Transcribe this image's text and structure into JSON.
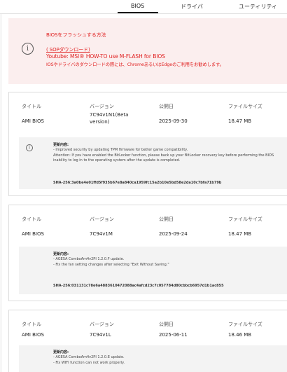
{
  "tabs": [
    {
      "label": "BIOS",
      "active": true
    },
    {
      "label": "ドライバ",
      "active": false
    },
    {
      "label": "ユーティリティ",
      "active": false
    }
  ],
  "notice": {
    "icon": "info-icon",
    "title": "BIOSをフラッシュする方法",
    "sop_link": "( SOPダウンロード)",
    "video_link": "Youtube: MSI® HOW-TO use M-FLASH for BIOS",
    "message": "IOSやドライバのダウンロードの際には、ChromeあるいはEdgeのご利用をお勧めします。",
    "color": "#e02020"
  },
  "columns": {
    "title": "タイトル",
    "version": "バージョン",
    "date": "公開日",
    "size": "ファイルサイズ"
  },
  "entries": [
    {
      "title": "AMI BIOS",
      "version_line1": "7C94v1N1(Beta",
      "version_line2": "version)",
      "date": "2025-09-30",
      "size": "18.47 MB",
      "details_title": "更新内容:",
      "details": [
        "- Improved security by updating TPM firmware for better game compatibility.",
        "Attention: If you have enabled the BitLocker function, please back up your BitLocker recovery key before performing the BIOS inability to log in to the operating system after the update is completed."
      ],
      "sha": "SHA-256:3a0be4e01ffd5f935b67e8a840ca1959fc15a2b10e5bd58e2da10c7bfa71b79b"
    },
    {
      "title": "AMI BIOS",
      "version_line1": "7C94v1M",
      "version_line2": "",
      "date": "2025-09-24",
      "size": "18.47 MB",
      "details_title": "更新内容:",
      "details": [
        "- AGESA ComboAm4v2PI 1.2.0.F update.",
        "- Fix the fan setting changes after selecting \"Exit Without Saving.\""
      ],
      "sha": "SHA-256:031131c78e6a4883610472088ac4afcd23c7c057784d80cbbcb6957d1b1ac855"
    },
    {
      "title": "AMI BIOS",
      "version_line1": "7C94v1L",
      "version_line2": "",
      "date": "2025-06-11",
      "size": "18.46 MB",
      "details_title": "更新内容:",
      "details": [
        "- AGESA ComboAm4v2PI 1.2.0.E update.",
        "- Fix WIFI function can not work properly."
      ],
      "sha": ""
    }
  ]
}
